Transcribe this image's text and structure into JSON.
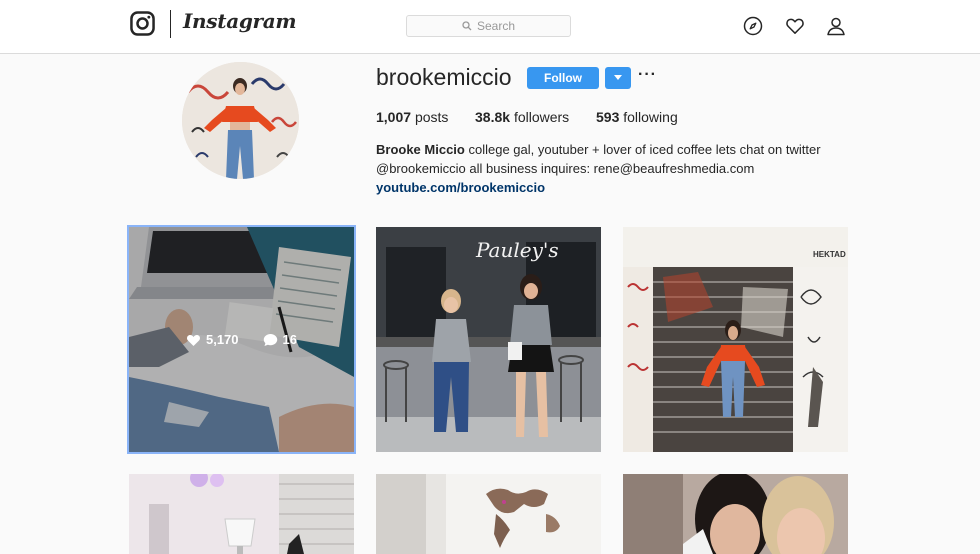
{
  "header": {
    "logo_word": "Instagram",
    "search_placeholder": "Search",
    "icons": [
      "instagram-glyph-icon",
      "compass-icon",
      "heart-icon",
      "person-icon"
    ]
  },
  "profile": {
    "username": "brookemiccio",
    "follow_label": "Follow",
    "more_label": "···",
    "stats": {
      "posts": {
        "value": "1,007",
        "label": "posts"
      },
      "followers": {
        "value": "38.8k",
        "label": "followers"
      },
      "following": {
        "value": "593",
        "label": "following"
      }
    },
    "bio": {
      "name": "Brooke Miccio",
      "text1": " college gal, youtuber + lover of iced coffee lets chat on twitter",
      "text2": "@brookemiccio all business inquires: rene@beaufreshmedia.com",
      "link": "youtube.com/brookemiccio"
    }
  },
  "posts": [
    {
      "id": "post-1",
      "likes": "5,170",
      "comments": "16"
    },
    {
      "id": "post-2",
      "sign_text": "Pauley's"
    },
    {
      "id": "post-3",
      "sign_text": "HEKTAD"
    },
    {
      "id": "post-4"
    },
    {
      "id": "post-5"
    },
    {
      "id": "post-6"
    }
  ],
  "colors": {
    "accent": "#3897f0",
    "link": "#003569",
    "border": "#dbdbdb",
    "background": "#fafafa"
  }
}
